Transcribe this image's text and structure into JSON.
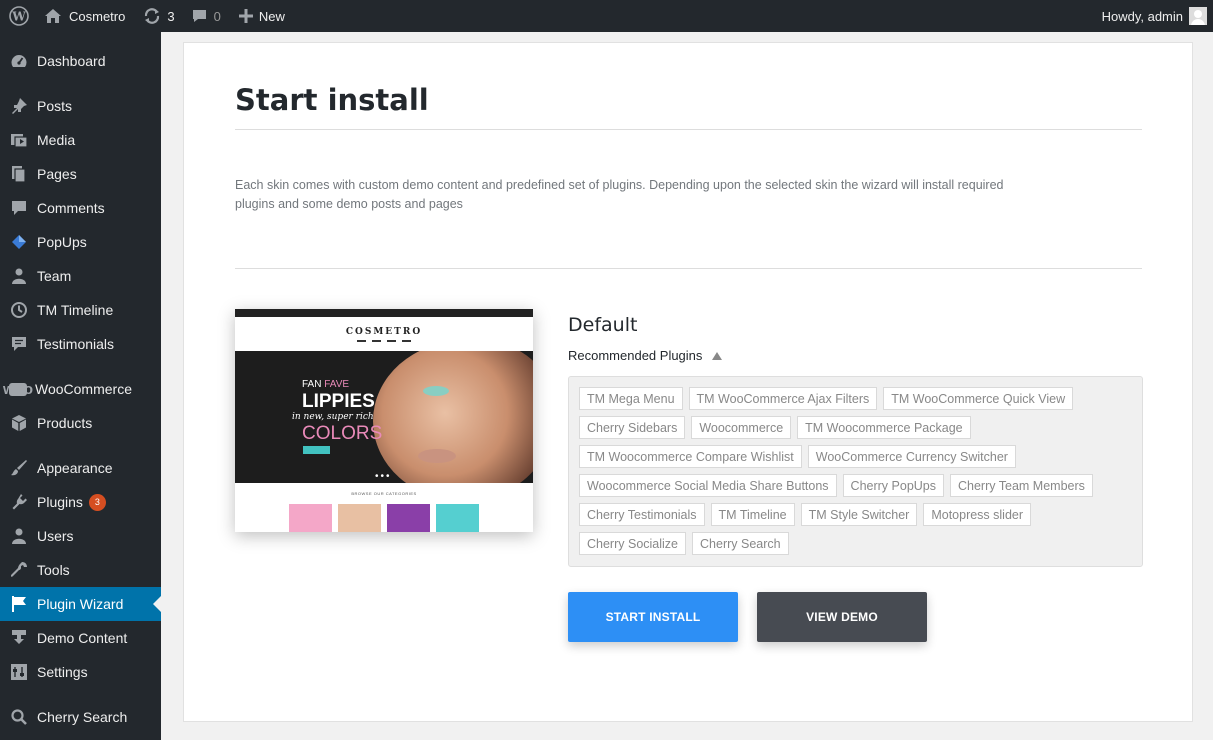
{
  "adminbar": {
    "site_name": "Cosmetro",
    "updates_count": "3",
    "comments_count": "0",
    "new_label": "New",
    "howdy": "Howdy, admin"
  },
  "sidebar": {
    "items": [
      {
        "label": "Dashboard",
        "icon": "dashboard-icon"
      },
      {
        "label": "Posts",
        "icon": "pin-icon"
      },
      {
        "label": "Media",
        "icon": "media-icon"
      },
      {
        "label": "Pages",
        "icon": "pages-icon"
      },
      {
        "label": "Comments",
        "icon": "comment-icon"
      },
      {
        "label": "PopUps",
        "icon": "popups-icon"
      },
      {
        "label": "Team",
        "icon": "team-icon"
      },
      {
        "label": "TM Timeline",
        "icon": "clock-icon"
      },
      {
        "label": "Testimonials",
        "icon": "testimonials-icon"
      },
      {
        "label": "WooCommerce",
        "icon": "woo-icon",
        "icon_text": "woo"
      },
      {
        "label": "Products",
        "icon": "box-icon"
      },
      {
        "label": "Appearance",
        "icon": "brush-icon"
      },
      {
        "label": "Plugins",
        "icon": "plugin-icon",
        "badge": "3"
      },
      {
        "label": "Users",
        "icon": "user-icon"
      },
      {
        "label": "Tools",
        "icon": "wrench-icon"
      },
      {
        "label": "Plugin Wizard",
        "icon": "flag-icon",
        "active": true
      },
      {
        "label": "Demo Content",
        "icon": "download-icon"
      },
      {
        "label": "Settings",
        "icon": "settings-icon"
      },
      {
        "label": "Cherry Search",
        "icon": "search-icon"
      }
    ]
  },
  "main": {
    "title": "Start install",
    "description": "Each skin comes with custom demo content and predefined set of plugins. Depending upon the selected skin the wizard will install required plugins and some demo posts and pages",
    "skin": {
      "name": "Default",
      "recommended_label": "Recommended Plugins",
      "preview": {
        "logo": "COSMETRO",
        "line1a": "FAN",
        "line1b": "FAVE",
        "line2": "LIPPIES",
        "line3": "in new, super rich",
        "line4": "COLORS",
        "subheading": "BROWSE OUR CATEGORIES"
      },
      "plugins": [
        "TM Mega Menu",
        "TM WooCommerce Ajax Filters",
        "TM WooCommerce Quick View",
        "Cherry Sidebars",
        "Woocommerce",
        "TM Woocommerce Package",
        "TM Woocommerce Compare Wishlist",
        "WooCommerce Currency Switcher",
        "Woocommerce Social Media Share Buttons",
        "Cherry PopUps",
        "Cherry Team Members",
        "Cherry Testimonials",
        "TM Timeline",
        "TM Style Switcher",
        "Motopress slider",
        "Cherry Socialize",
        "Cherry Search"
      ]
    },
    "buttons": {
      "start_install": "START INSTALL",
      "view_demo": "VIEW DEMO"
    }
  },
  "colors": {
    "accent": "#0073aa",
    "install_button": "#2d8ff5",
    "demo_button": "#474b52",
    "badge": "#d54e21"
  }
}
